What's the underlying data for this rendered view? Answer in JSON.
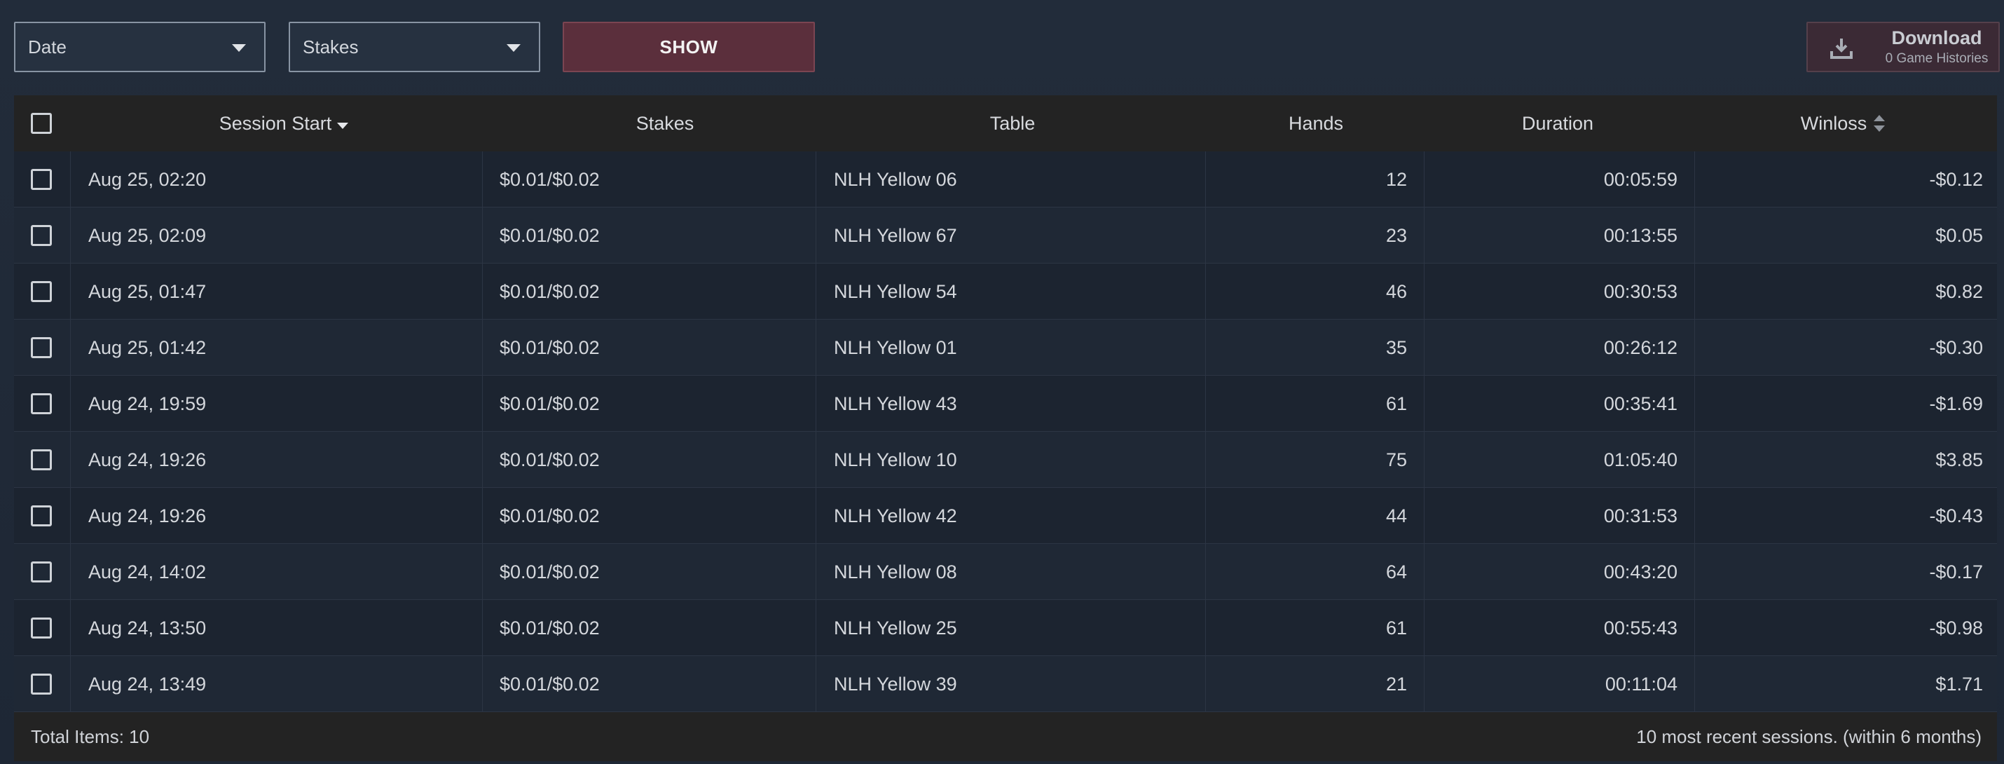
{
  "filters": {
    "date_label": "Date",
    "stakes_label": "Stakes",
    "show_label": "SHOW"
  },
  "download": {
    "title": "Download",
    "subtitle": "0 Game Histories",
    "icon": "download-icon"
  },
  "table": {
    "headers": {
      "session_start": "Session Start",
      "stakes": "Stakes",
      "table": "Table",
      "hands": "Hands",
      "duration": "Duration",
      "winloss": "Winloss"
    },
    "rows": [
      {
        "session_start": "Aug 25, 02:20",
        "stakes": "$0.01/$0.02",
        "table": "NLH Yellow 06",
        "hands": "12",
        "duration": "00:05:59",
        "winloss": "-$0.12"
      },
      {
        "session_start": "Aug 25, 02:09",
        "stakes": "$0.01/$0.02",
        "table": "NLH Yellow 67",
        "hands": "23",
        "duration": "00:13:55",
        "winloss": "$0.05"
      },
      {
        "session_start": "Aug 25, 01:47",
        "stakes": "$0.01/$0.02",
        "table": "NLH Yellow 54",
        "hands": "46",
        "duration": "00:30:53",
        "winloss": "$0.82"
      },
      {
        "session_start": "Aug 25, 01:42",
        "stakes": "$0.01/$0.02",
        "table": "NLH Yellow 01",
        "hands": "35",
        "duration": "00:26:12",
        "winloss": "-$0.30"
      },
      {
        "session_start": "Aug 24, 19:59",
        "stakes": "$0.01/$0.02",
        "table": "NLH Yellow 43",
        "hands": "61",
        "duration": "00:35:41",
        "winloss": "-$1.69"
      },
      {
        "session_start": "Aug 24, 19:26",
        "stakes": "$0.01/$0.02",
        "table": "NLH Yellow 10",
        "hands": "75",
        "duration": "01:05:40",
        "winloss": "$3.85"
      },
      {
        "session_start": "Aug 24, 19:26",
        "stakes": "$0.01/$0.02",
        "table": "NLH Yellow 42",
        "hands": "44",
        "duration": "00:31:53",
        "winloss": "-$0.43"
      },
      {
        "session_start": "Aug 24, 14:02",
        "stakes": "$0.01/$0.02",
        "table": "NLH Yellow 08",
        "hands": "64",
        "duration": "00:43:20",
        "winloss": "-$0.17"
      },
      {
        "session_start": "Aug 24, 13:50",
        "stakes": "$0.01/$0.02",
        "table": "NLH Yellow 25",
        "hands": "61",
        "duration": "00:55:43",
        "winloss": "-$0.98"
      },
      {
        "session_start": "Aug 24, 13:49",
        "stakes": "$0.01/$0.02",
        "table": "NLH Yellow 39",
        "hands": "21",
        "duration": "00:11:04",
        "winloss": "$1.71"
      }
    ]
  },
  "footer": {
    "total_items": "Total Items: 10",
    "note": "10 most recent sessions. (within 6 months)"
  },
  "colors": {
    "background": "#1f2937",
    "accent_button": "#5b2f3c",
    "header_bg": "#232323"
  }
}
